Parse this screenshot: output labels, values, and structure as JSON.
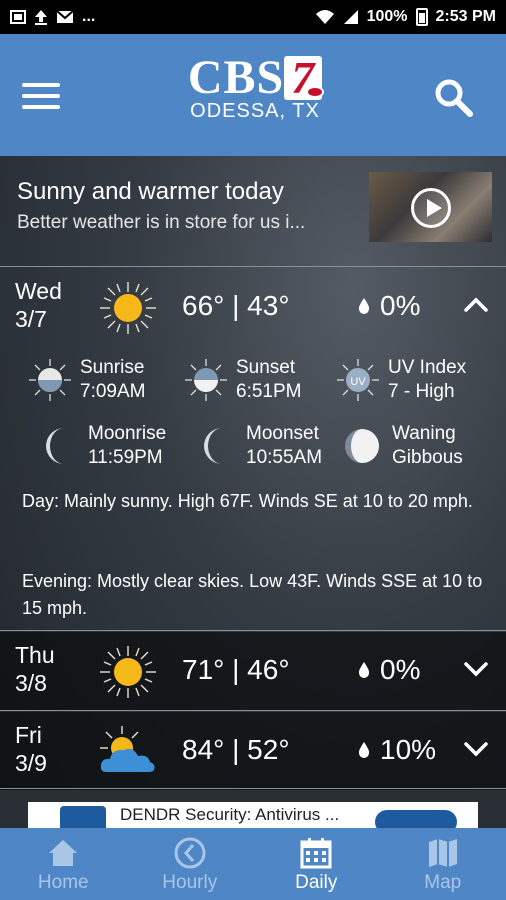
{
  "status_bar": {
    "battery": "100%",
    "time": "2:53 PM",
    "left_text": "..."
  },
  "header": {
    "logo_text": "CBS",
    "logo_number": "7",
    "city": "ODESSA, TX"
  },
  "headline": {
    "title": "Sunny and warmer today",
    "subtitle": "Better weather is in store for us i..."
  },
  "days": [
    {
      "day": "Wed",
      "date": "3/7",
      "icon": "sun-icon",
      "temps": "66° | 43°",
      "precip": "0%",
      "expanded": true
    },
    {
      "day": "Thu",
      "date": "3/8",
      "icon": "sun-icon",
      "temps": "71° | 46°",
      "precip": "0%",
      "expanded": false
    },
    {
      "day": "Fri",
      "date": "3/9",
      "icon": "partly-cloudy-icon",
      "temps": "84° | 52°",
      "precip": "10%",
      "expanded": false
    }
  ],
  "details": {
    "sunrise": {
      "label": "Sunrise",
      "value": "7:09AM"
    },
    "sunset": {
      "label": "Sunset",
      "value": "6:51PM"
    },
    "uv": {
      "label": "UV Index",
      "value": "7 - High",
      "icon_text": "UV"
    },
    "moonrise": {
      "label": "Moonrise",
      "value": "11:59PM"
    },
    "moonset": {
      "label": "Moonset",
      "value": "10:55AM"
    },
    "moon_phase": {
      "line1": "Waning",
      "line2": "Gibbous"
    },
    "day_text": "Day: Mainly sunny. High 67F. Winds SE at 10 to 20 mph.",
    "evening_text": "Evening: Mostly clear skies. Low 43F. Winds SSE at 10 to 15 mph."
  },
  "ad": {
    "text": "DENDR Security: Antivirus ..."
  },
  "tabs": [
    {
      "label": "Home",
      "icon": "home-icon",
      "active": false
    },
    {
      "label": "Hourly",
      "icon": "clock-icon",
      "active": false
    },
    {
      "label": "Daily",
      "icon": "calendar-icon",
      "active": true
    },
    {
      "label": "Map",
      "icon": "map-icon",
      "active": false
    }
  ],
  "colors": {
    "accent": "#4f86c6",
    "sun": "#f7b81a",
    "tab_inactive": "#a9c6e8"
  }
}
